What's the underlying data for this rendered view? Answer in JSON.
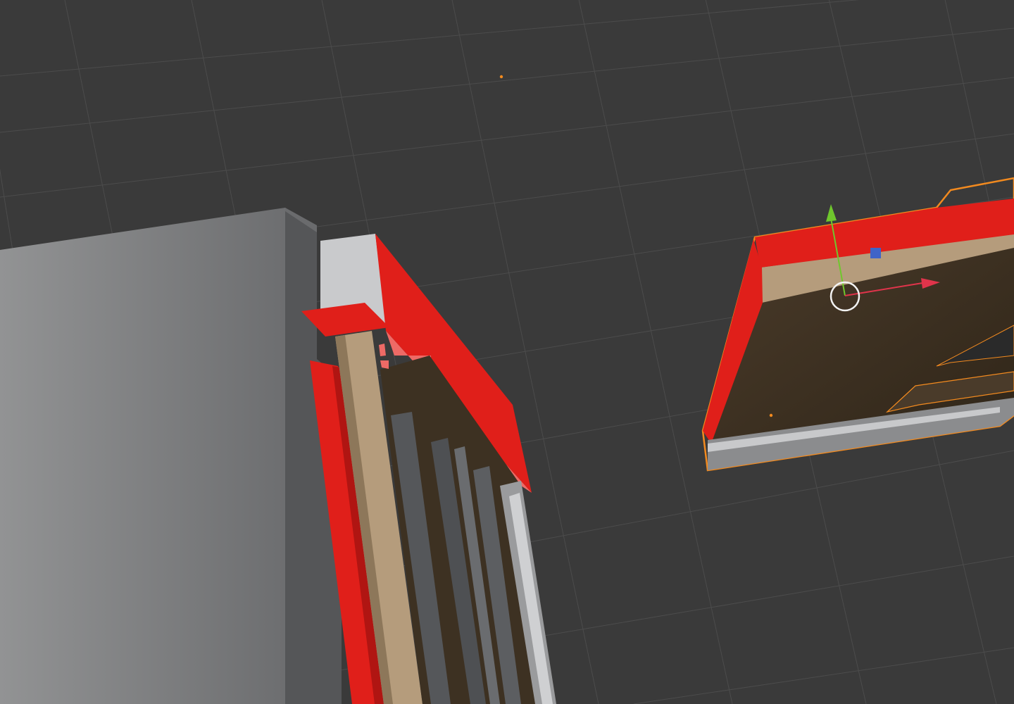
{
  "viewport": {
    "background_color": "#3a3a3a",
    "grid_color": "#4a4a4a",
    "grid_visible": true
  },
  "colors": {
    "red_surface": "#e01f1a",
    "red_light": "#ee6a66",
    "wood_light": "#b59c7c",
    "wood_dark": "#3a2e20",
    "gray_box": "#8a8b8d",
    "selection_outline": "#f28a1f",
    "gizmo_x": "#e0344b",
    "gizmo_y": "#6fc72d",
    "gizmo_z": "#3f64c8"
  },
  "objects": [
    {
      "name": "cabinet-box",
      "selected": false
    },
    {
      "name": "drawer-unit-red-frame",
      "selected": false
    },
    {
      "name": "drawer-panel",
      "selected": true
    }
  ],
  "gizmo": {
    "axes": [
      "x-axis",
      "y-axis",
      "z-axis"
    ],
    "icons": [
      "transform-gizmo-icon",
      "pivot-circle-icon"
    ]
  }
}
